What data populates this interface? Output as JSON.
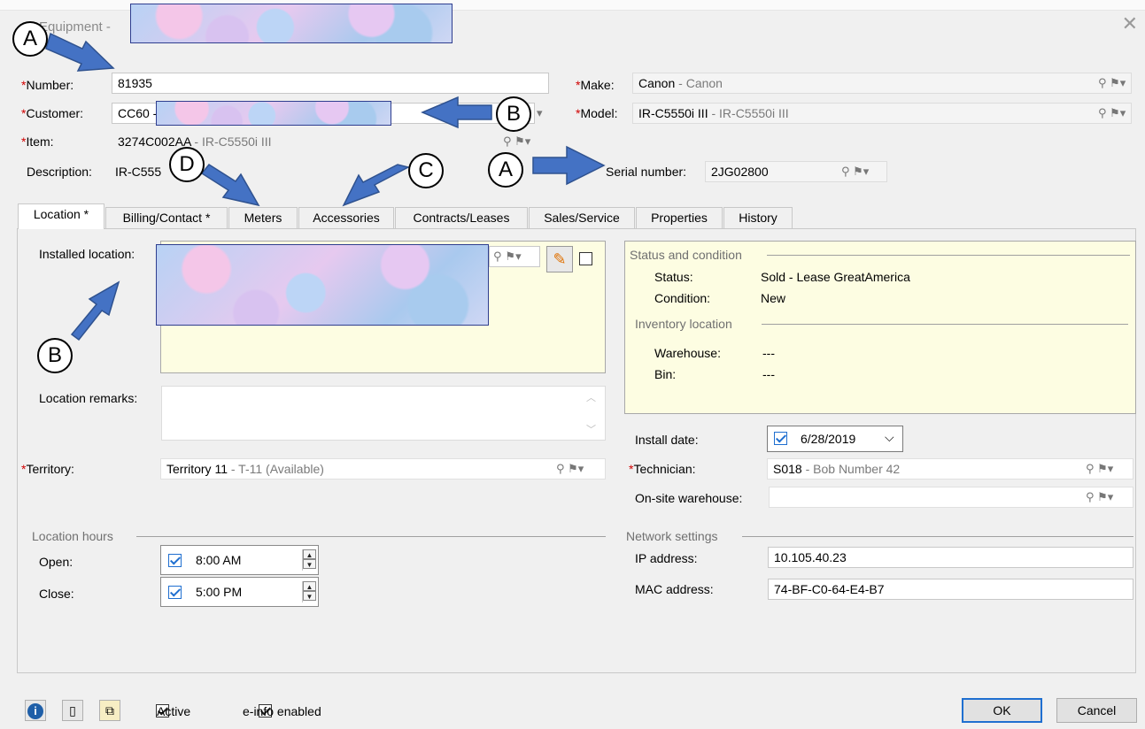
{
  "window": {
    "title": "Equipment -",
    "close_glyph": "✕"
  },
  "header": {
    "number": {
      "label": "Number:",
      "value": "81935"
    },
    "customer": {
      "label": "Customer:",
      "value": "CC60 -"
    },
    "item": {
      "label": "Item:",
      "code": "3274C002AA",
      "desc": " - IR-C5550i III"
    },
    "description": {
      "label": "Description:",
      "value": "IR-C555"
    },
    "make": {
      "label": "Make:",
      "code": "Canon",
      "desc": " - Canon"
    },
    "model": {
      "label": "Model:",
      "code": "IR-C5550i III",
      "desc": " - IR-C5550i III"
    },
    "serial": {
      "label": "Serial number:",
      "value": "2JG02800"
    }
  },
  "icons": {
    "lookup": "⚲",
    "flag": "⚑▾",
    "edit": "✎",
    "info": "i",
    "clip": "▯",
    "copy": "⧉"
  },
  "tabs": [
    {
      "label": "Location *"
    },
    {
      "label": "Billing/Contact *"
    },
    {
      "label": "Meters"
    },
    {
      "label": "Accessories"
    },
    {
      "label": "Contracts/Leases"
    },
    {
      "label": "Sales/Service"
    },
    {
      "label": "Properties"
    },
    {
      "label": "History"
    }
  ],
  "location": {
    "installed_location_label": "Installed location:",
    "location_remarks_label": "Location remarks:",
    "territory": {
      "label": "Territory:",
      "code": "Territory 11",
      "desc": " - T-11  (Available)"
    },
    "hours": {
      "group_label": "Location hours",
      "open": {
        "label": "Open:",
        "value": "8:00 AM",
        "checked": true
      },
      "close": {
        "label": "Close:",
        "value": "5:00 PM",
        "checked": true
      }
    }
  },
  "status_condition": {
    "group_label": "Status and condition",
    "status": {
      "label": "Status:",
      "value": "Sold - Lease GreatAmerica"
    },
    "condition": {
      "label": "Condition:",
      "value": "New"
    },
    "inventory_group_label": "Inventory location",
    "warehouse": {
      "label": "Warehouse:",
      "value": "---"
    },
    "bin": {
      "label": "Bin:",
      "value": "---"
    }
  },
  "install": {
    "install_date": {
      "label": "Install date:",
      "value": "6/28/2019",
      "checked": true
    },
    "technician": {
      "label": "Technician:",
      "code": "S018",
      "desc": " - Bob Number 42"
    },
    "onsite_warehouse": {
      "label": "On-site warehouse:",
      "value": ""
    }
  },
  "network": {
    "group_label": "Network settings",
    "ip": {
      "label": "IP address:",
      "value": "10.105.40.23"
    },
    "mac": {
      "label": "MAC address:",
      "value": "74-BF-C0-64-E4-B7"
    }
  },
  "footer": {
    "active": {
      "label": "Active",
      "checked": true
    },
    "einfo": {
      "label": "e-info enabled",
      "checked": true
    },
    "ok_label": "OK",
    "cancel_label": "Cancel"
  },
  "callouts": [
    "A",
    "B",
    "D",
    "C",
    "A",
    "B"
  ],
  "colors": {
    "arrow": "#4472c4",
    "arrow_stroke": "#2f528f",
    "required": "#d00000",
    "panel_yellow": "#fdfde2",
    "default_button": "#1f6fd0"
  }
}
